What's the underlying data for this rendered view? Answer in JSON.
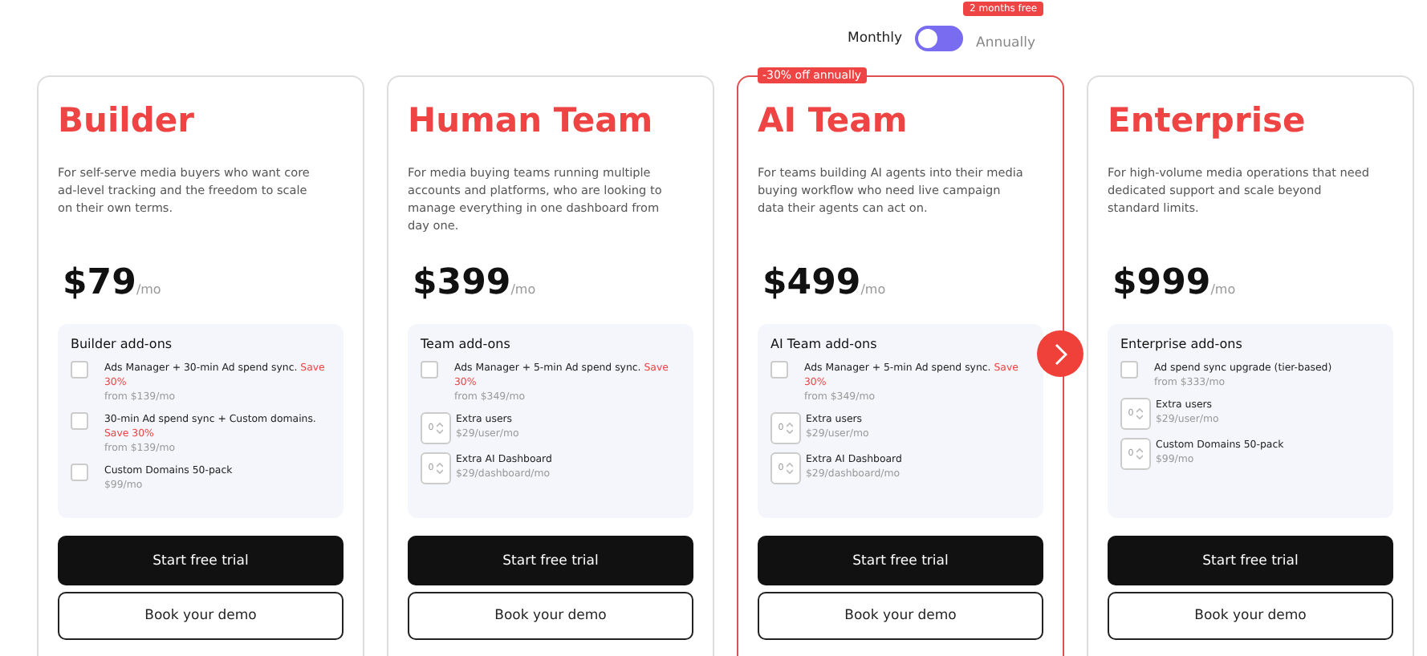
{
  "billing": {
    "badge": "2 months free",
    "options": [
      {
        "label": "Monthly",
        "selected": true
      },
      {
        "label": "Annually",
        "selected": false
      }
    ]
  },
  "plans": [
    {
      "name": "Builder",
      "highlighted": false,
      "description": "For self-serve media buyers who want core ad-level tracking and the freedom to scale on their own terms.",
      "price": "$79",
      "period": "/mo",
      "addons_title": "Builder add-ons",
      "addons": [
        {
          "kind": "checkbox",
          "checked": false,
          "title": "Ads Manager + 30-min Ad spend sync.",
          "save": "Save 30%",
          "price": "from $139/mo"
        },
        {
          "kind": "checkbox",
          "checked": false,
          "title": "30-min Ad spend sync + Custom domains.",
          "save": "Save 30%",
          "price": "from $139/mo"
        },
        {
          "kind": "checkbox",
          "checked": false,
          "title": "Custom Domains 50-pack",
          "price": "$99/mo"
        }
      ],
      "primary": "Start free trial",
      "secondary": "Book your demo"
    },
    {
      "name": "Human Team",
      "highlighted": false,
      "description": "For media buying teams running multiple accounts and platforms, who are looking to manage everything in one dashboard from day one.",
      "price": "$399",
      "period": "/mo",
      "addons_title": "Team add-ons",
      "addons": [
        {
          "kind": "checkbox",
          "checked": false,
          "title": "Ads Manager + 5-min Ad spend sync.",
          "save": "Save 30%",
          "price": "from $349/mo"
        },
        {
          "kind": "counter",
          "value": "0",
          "title": "Extra users",
          "price": "$29/user/mo"
        },
        {
          "kind": "counter",
          "value": "0",
          "title": "Extra AI Dashboard",
          "price": "$29/dashboard/mo"
        }
      ],
      "primary": "Start free trial",
      "secondary": "Book your demo"
    },
    {
      "name": "AI Team",
      "highlighted": true,
      "badge": "-30% off annually",
      "description": "For teams building AI agents into their media buying workflow who need live campaign data their agents can act on.",
      "price": "$499",
      "period": "/mo",
      "addons_title": "AI Team add-ons",
      "addons": [
        {
          "kind": "checkbox",
          "checked": false,
          "title": "Ads Manager + 5-min Ad spend sync.",
          "save": "Save 30%",
          "price": "from $349/mo"
        },
        {
          "kind": "counter",
          "value": "0",
          "title": "Extra users",
          "price": "$29/user/mo"
        },
        {
          "kind": "counter",
          "value": "0",
          "title": "Extra AI Dashboard",
          "price": "$29/dashboard/mo"
        }
      ],
      "primary": "Start free trial",
      "secondary": "Book your demo"
    },
    {
      "name": "Enterprise",
      "highlighted": false,
      "description": "For high-volume media operations that need dedicated support and scale beyond standard limits.",
      "price": "$999",
      "period": "/mo",
      "addons_title": "Enterprise add-ons",
      "addons": [
        {
          "kind": "checkbox",
          "checked": false,
          "title": "Ad spend sync upgrade (tier-based)",
          "price": "from $333/mo"
        },
        {
          "kind": "counter",
          "value": "0",
          "title": "Extra users",
          "price": "$29/user/mo"
        },
        {
          "kind": "counter",
          "value": "0",
          "title": "Custom Domains 50-pack",
          "price": "$99/mo"
        }
      ],
      "primary": "Start free trial",
      "secondary": "Book your demo"
    }
  ]
}
